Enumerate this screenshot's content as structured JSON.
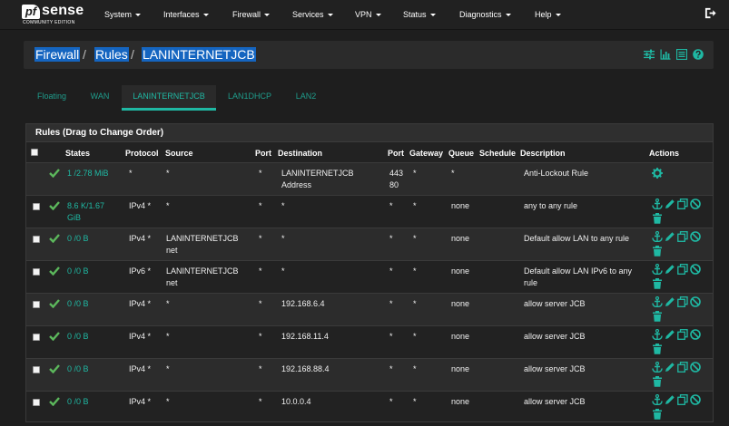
{
  "brand": {
    "pf": "pf",
    "sense": "sense",
    "edition": "COMMUNITY EDITION"
  },
  "nav": [
    {
      "label": "System"
    },
    {
      "label": "Interfaces"
    },
    {
      "label": "Firewall"
    },
    {
      "label": "Services"
    },
    {
      "label": "VPN"
    },
    {
      "label": "Status"
    },
    {
      "label": "Diagnostics"
    },
    {
      "label": "Help"
    }
  ],
  "breadcrumb": {
    "firewall": "Firewall",
    "rules": "Rules",
    "current": "LANINTERNETJCB",
    "sep": "/"
  },
  "tabs": [
    "Floating",
    "WAN",
    "LANINTERNETJCB",
    "LAN1DHCP",
    "LAN2"
  ],
  "panel": {
    "title": "Rules (Drag to Change Order)"
  },
  "columns": {
    "states": "States",
    "protocol": "Protocol",
    "source": "Source",
    "port": "Port",
    "destination": "Destination",
    "dport": "Port",
    "gateway": "Gateway",
    "queue": "Queue",
    "schedule": "Schedule",
    "description": "Description",
    "actions": "Actions"
  },
  "rows": [
    {
      "states_1": "1 /2.78 MiB",
      "states_2": "",
      "protocol": "*",
      "source_1": "*",
      "source_2": "",
      "port": "*",
      "dest_1": "LANINTERNETJCB",
      "dest_2": "Address",
      "dport_1": "443",
      "dport_2": "80",
      "gateway": "*",
      "queue": "*",
      "desc_1": "Anti-Lockout Rule",
      "desc_2": ""
    },
    {
      "states_1": "8.6 K/1.67",
      "states_2": "GiB",
      "protocol": "IPv4 *",
      "source_1": "*",
      "source_2": "",
      "port": "*",
      "dest_1": "*",
      "dest_2": "",
      "dport_1": "*",
      "dport_2": "",
      "gateway": "*",
      "queue": "none",
      "desc_1": "any to any rule",
      "desc_2": ""
    },
    {
      "states_1": "0 /0 B",
      "states_2": "",
      "protocol": "IPv4 *",
      "source_1": "LANINTERNETJCB",
      "source_2": "net",
      "port": "*",
      "dest_1": "*",
      "dest_2": "",
      "dport_1": "*",
      "dport_2": "",
      "gateway": "*",
      "queue": "none",
      "desc_1": "Default allow LAN to any rule",
      "desc_2": ""
    },
    {
      "states_1": "0 /0 B",
      "states_2": "",
      "protocol": "IPv6 *",
      "source_1": "LANINTERNETJCB",
      "source_2": "net",
      "port": "*",
      "dest_1": "*",
      "dest_2": "",
      "dport_1": "*",
      "dport_2": "",
      "gateway": "*",
      "queue": "none",
      "desc_1": "Default allow LAN IPv6 to any",
      "desc_2": "rule"
    },
    {
      "states_1": "0 /0 B",
      "states_2": "",
      "protocol": "IPv4 *",
      "source_1": "*",
      "source_2": "",
      "port": "*",
      "dest_1": "192.168.6.4",
      "dest_2": "",
      "dport_1": "*",
      "dport_2": "",
      "gateway": "*",
      "queue": "none",
      "desc_1": "allow server JCB",
      "desc_2": ""
    },
    {
      "states_1": "0 /0 B",
      "states_2": "",
      "protocol": "IPv4 *",
      "source_1": "*",
      "source_2": "",
      "port": "*",
      "dest_1": "192.168.11.4",
      "dest_2": "",
      "dport_1": "*",
      "dport_2": "",
      "gateway": "*",
      "queue": "none",
      "desc_1": "allow server JCB",
      "desc_2": ""
    },
    {
      "states_1": "0 /0 B",
      "states_2": "",
      "protocol": "IPv4 *",
      "source_1": "*",
      "source_2": "",
      "port": "*",
      "dest_1": "192.168.88.4",
      "dest_2": "",
      "dport_1": "*",
      "dport_2": "",
      "gateway": "*",
      "queue": "none",
      "desc_1": "allow server JCB",
      "desc_2": ""
    },
    {
      "states_1": "0 /0 B",
      "states_2": "",
      "protocol": "IPv4 *",
      "source_1": "*",
      "source_2": "",
      "port": "*",
      "dest_1": "10.0.0.4",
      "dest_2": "",
      "dport_1": "*",
      "dport_2": "",
      "gateway": "*",
      "queue": "none",
      "desc_1": "allow server JCB",
      "desc_2": ""
    }
  ],
  "icons": {
    "logout": "sign-out-icon",
    "settings": "sliders-icon",
    "chart": "bar-chart-icon",
    "list": "list-icon",
    "help": "question-circle-icon",
    "gear": "gear-icon",
    "anchor": "anchor-icon",
    "edit": "pencil-icon",
    "copy": "copy-icon",
    "disable": "ban-icon",
    "delete": "trash-icon",
    "pass": "check-icon"
  },
  "colors": {
    "accent": "#1fb8a3",
    "pass_green": "#5cb85c",
    "selection": "#1565c0",
    "background": "#1e1e1e"
  }
}
